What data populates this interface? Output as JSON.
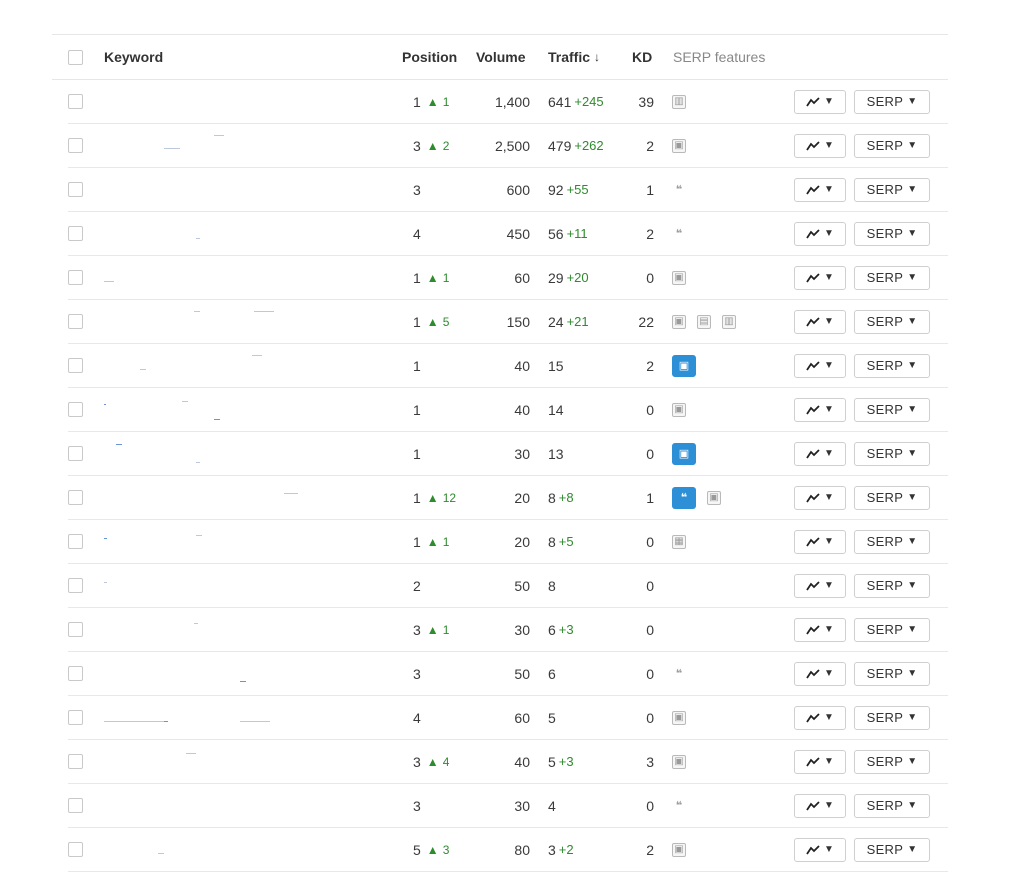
{
  "header": {
    "keyword": "Keyword",
    "position": "Position",
    "volume": "Volume",
    "traffic": "Traffic",
    "sort_icon": "↓",
    "kd": "KD",
    "serp_features": "SERP features"
  },
  "actions": {
    "trend_icon": "trend-chart-icon",
    "serp_label": "SERP",
    "caret": "▼"
  },
  "rows": [
    {
      "position": "1",
      "change": "1",
      "volume": "1,400",
      "traffic": "641",
      "delta": "+245",
      "kd": "39",
      "features": [
        "sitelinks"
      ]
    },
    {
      "position": "3",
      "change": "2",
      "volume": "2,500",
      "traffic": "479",
      "delta": "+262",
      "kd": "2",
      "features": [
        "image"
      ]
    },
    {
      "position": "3",
      "change": "",
      "volume": "600",
      "traffic": "92",
      "delta": "+55",
      "kd": "1",
      "features": [
        "quote"
      ]
    },
    {
      "position": "4",
      "change": "",
      "volume": "450",
      "traffic": "56",
      "delta": "+11",
      "kd": "2",
      "features": [
        "quote"
      ]
    },
    {
      "position": "1",
      "change": "1",
      "volume": "60",
      "traffic": "29",
      "delta": "+20",
      "kd": "0",
      "features": [
        "image"
      ]
    },
    {
      "position": "1",
      "change": "5",
      "volume": "150",
      "traffic": "24",
      "delta": "+21",
      "kd": "22",
      "features": [
        "image",
        "video",
        "sitelinks"
      ]
    },
    {
      "position": "1",
      "change": "",
      "volume": "40",
      "traffic": "15",
      "delta": "",
      "kd": "2",
      "features": [
        "image-active"
      ]
    },
    {
      "position": "1",
      "change": "",
      "volume": "40",
      "traffic": "14",
      "delta": "",
      "kd": "0",
      "features": [
        "image"
      ]
    },
    {
      "position": "1",
      "change": "",
      "volume": "30",
      "traffic": "13",
      "delta": "",
      "kd": "0",
      "features": [
        "image-active"
      ]
    },
    {
      "position": "1",
      "change": "12",
      "volume": "20",
      "traffic": "8",
      "delta": "+8",
      "kd": "1",
      "features": [
        "quote-active",
        "image"
      ]
    },
    {
      "position": "1",
      "change": "1",
      "volume": "20",
      "traffic": "8",
      "delta": "+5",
      "kd": "0",
      "features": [
        "top-stories"
      ]
    },
    {
      "position": "2",
      "change": "",
      "volume": "50",
      "traffic": "8",
      "delta": "",
      "kd": "0",
      "features": []
    },
    {
      "position": "3",
      "change": "1",
      "volume": "30",
      "traffic": "6",
      "delta": "+3",
      "kd": "0",
      "features": []
    },
    {
      "position": "3",
      "change": "",
      "volume": "50",
      "traffic": "6",
      "delta": "",
      "kd": "0",
      "features": [
        "quote"
      ]
    },
    {
      "position": "4",
      "change": "",
      "volume": "60",
      "traffic": "5",
      "delta": "",
      "kd": "0",
      "features": [
        "image"
      ]
    },
    {
      "position": "3",
      "change": "4",
      "volume": "40",
      "traffic": "5",
      "delta": "+3",
      "kd": "3",
      "features": [
        "image"
      ]
    },
    {
      "position": "3",
      "change": "",
      "volume": "30",
      "traffic": "4",
      "delta": "",
      "kd": "0",
      "features": [
        "quote"
      ]
    },
    {
      "position": "5",
      "change": "3",
      "volume": "80",
      "traffic": "3",
      "delta": "+2",
      "kd": "2",
      "features": [
        "image"
      ]
    }
  ],
  "colors": {
    "accent": "#2d8fd6",
    "positive": "#2e8b2e"
  }
}
